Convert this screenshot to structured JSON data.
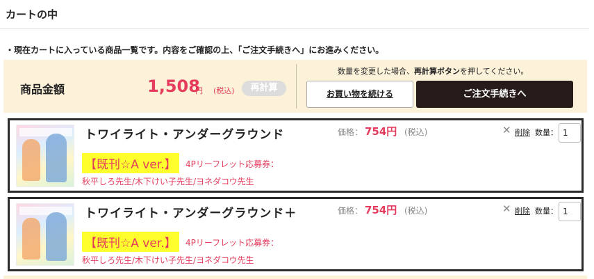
{
  "page": {
    "title": "カートの中",
    "notice": "・現在カートに入っている商品一覧です。内容をご確認の上、「ご注文手続きへ」にお進みください。"
  },
  "summary": {
    "label": "商品金額",
    "amount": "1,508",
    "unit": "円",
    "tax": "(税込)",
    "recalc_label": "再計算",
    "hint_pre": "数量を変更した場合、",
    "hint_strong": "再計算ボタン",
    "hint_post": "を押してください。",
    "continue_label": "お買い物を続ける",
    "checkout_label": "ご注文手続きへ"
  },
  "items": [
    {
      "title": "トワイライト・アンダーグラウンド",
      "edition": "【既刊☆A ver.】",
      "coupon": "4Pリーフレット応募券：",
      "authors": "秋平しろ先生/木下けい子先生/ヨネダコウ先生",
      "price_label": "価格：",
      "price": "754円",
      "price_tax": "(税込)",
      "delete_label": "削除",
      "qty_label": "数量：",
      "qty": "1"
    },
    {
      "title": "トワイライト・アンダーグラウンド＋",
      "edition": "【既刊☆A ver.】",
      "coupon": "4Pリーフレット応募券：",
      "authors": "秋平しろ先生/木下けい子先生/ヨネダコウ先生",
      "price_label": "価格：",
      "price": "754円",
      "price_tax": "(税込)",
      "delete_label": "削除",
      "qty_label": "数量：",
      "qty": "1"
    }
  ],
  "icons": {
    "delete": "close-icon",
    "cover": "book-cover-image"
  },
  "colors": {
    "accent": "#e53c5d",
    "checkout_bg": "#261b18",
    "summary_bg": "#fcf2da",
    "highlight": "#ffff2e"
  }
}
